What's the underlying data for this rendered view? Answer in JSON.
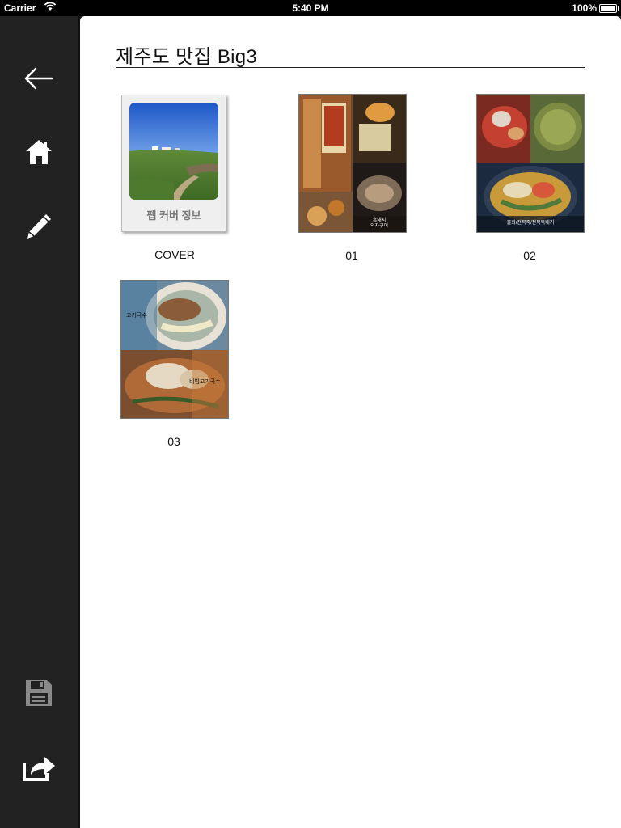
{
  "status_bar": {
    "carrier": "Carrier",
    "time": "5:40 PM",
    "battery": "100%",
    "battery_level": 1.0
  },
  "sidebar": {
    "items": [
      {
        "icon": "back-arrow-icon"
      },
      {
        "icon": "home-icon"
      },
      {
        "icon": "pencil-icon"
      },
      {
        "icon": "save-icon"
      },
      {
        "icon": "share-icon"
      }
    ]
  },
  "main": {
    "title": "제주도 맛집 Big3",
    "pages": [
      {
        "label": "COVER",
        "caption": "펩 커버 정보"
      },
      {
        "label": "01",
        "overlay": "흑돼지\n의자구이"
      },
      {
        "label": "02",
        "overlay": "물회/전복죽/전복뚝배기"
      },
      {
        "label": "03",
        "overlay_top": "고기국수",
        "overlay_bottom": "비빔고기국수"
      }
    ]
  },
  "colors": {
    "sidebar_bg": "#222222",
    "content_bg": "#ffffff",
    "status_bar_bg": "#000000"
  }
}
